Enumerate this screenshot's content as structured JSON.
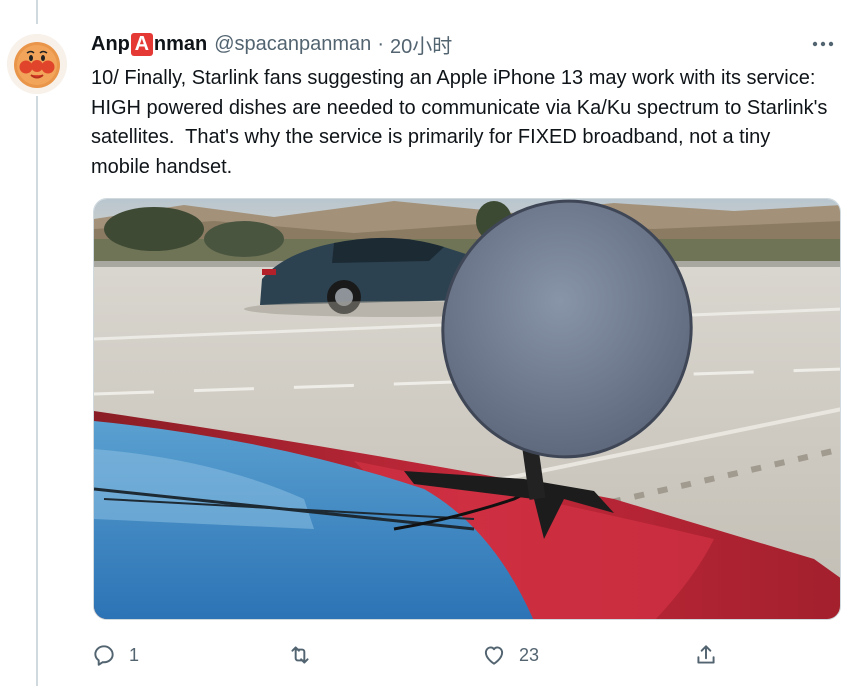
{
  "tweet": {
    "author_name_prefix": "Anp",
    "author_name_badge": "A",
    "author_name_suffix": "nman",
    "handle": "@spacanpanman",
    "separator": "·",
    "time": "20小时",
    "more_icon": "more-horizontal-icon",
    "text": "10/ Finally, Starlink fans suggesting an Apple iPhone 13 may work with its service: HIGH powered dishes are needed to communicate via Ka/Ku spectrum to Starlink's satellites.  That's why the service is primarily for FIXED broadband, not a tiny mobile handset.",
    "media_icon": "photo-starlink-dish-on-car",
    "actions": {
      "reply_count": "1",
      "retweet_count": "",
      "like_count": "23",
      "share_count": ""
    }
  },
  "colors": {
    "text": "#0f1419",
    "secondary": "#536471",
    "border": "#cfd9de",
    "badge": "#e53935"
  }
}
